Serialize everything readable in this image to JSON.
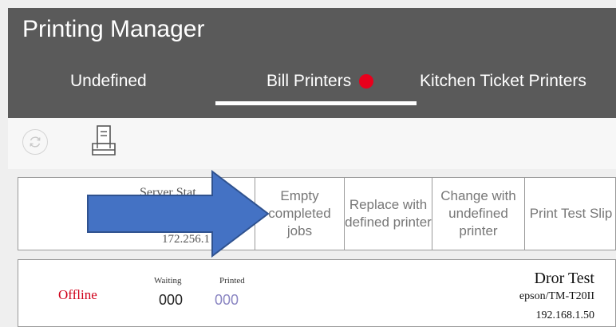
{
  "header": {
    "title": "Printing Manager",
    "tabs": [
      {
        "label": "Undefined"
      },
      {
        "label": "Bill Printers",
        "alert": true
      },
      {
        "label": "Kitchen Ticket Printers"
      }
    ],
    "active_tab": "Bill Printers"
  },
  "toolbar": {
    "refresh_icon": "refresh-icon",
    "printer_icon": "printer-icon"
  },
  "actions": {
    "server_status_line1": "Server Stat",
    "server_status_line2": "172.256.1",
    "empty_completed_jobs": "Empty completed jobs",
    "replace_with_defined": "Replace with defined printer",
    "change_with_undefined": "Change with undefined printer",
    "print_test_slip": "Print Test Slip"
  },
  "printer": {
    "status": "Offline",
    "waiting_label": "Waiting",
    "waiting_count": "000",
    "printed_label": "Printed",
    "printed_count": "000",
    "name": "Dror Test",
    "model": "epson/TM-T20II",
    "ip": "192.168.1.50"
  },
  "colors": {
    "header_bg": "#5a5a5a",
    "alert_dot": "#e8001c",
    "offline": "#d0021b",
    "arrow_fill": "#4472c4",
    "arrow_stroke": "#2f528f"
  }
}
